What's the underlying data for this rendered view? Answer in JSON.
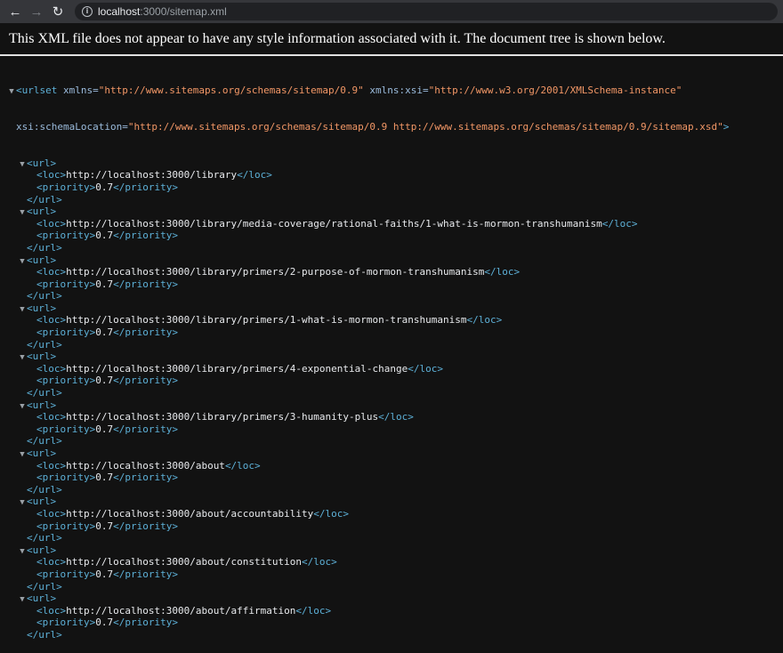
{
  "browser": {
    "url_host": "localhost",
    "url_path": ":3000/sitemap.xml"
  },
  "banner": "This XML file does not appear to have any style information associated with it. The document tree is shown below.",
  "root": {
    "tag": "urlset",
    "attr1_name": "xmlns",
    "attr1_value": "\"http://www.sitemaps.org/schemas/sitemap/0.9\"",
    "attr2_name": "xmlns:xsi",
    "attr2_value": "\"http://www.w3.org/2001/XMLSchema-instance\"",
    "attr3_name": "xsi:schemaLocation",
    "attr3_value": "\"http://www.sitemaps.org/schemas/sitemap/0.9 http://www.sitemaps.org/schemas/sitemap/0.9/sitemap.xsd\""
  },
  "urls": [
    {
      "loc": "http://localhost:3000/library",
      "priority": "0.7"
    },
    {
      "loc": "http://localhost:3000/library/media-coverage/rational-faiths/1-what-is-mormon-transhumanism",
      "priority": "0.7"
    },
    {
      "loc": "http://localhost:3000/library/primers/2-purpose-of-mormon-transhumanism",
      "priority": "0.7"
    },
    {
      "loc": "http://localhost:3000/library/primers/1-what-is-mormon-transhumanism",
      "priority": "0.7"
    },
    {
      "loc": "http://localhost:3000/library/primers/4-exponential-change",
      "priority": "0.7"
    },
    {
      "loc": "http://localhost:3000/library/primers/3-humanity-plus",
      "priority": "0.7"
    },
    {
      "loc": "http://localhost:3000/about",
      "priority": "0.7"
    },
    {
      "loc": "http://localhost:3000/about/accountability",
      "priority": "0.7"
    },
    {
      "loc": "http://localhost:3000/about/constitution",
      "priority": "0.7"
    },
    {
      "loc": "http://localhost:3000/about/affirmation",
      "priority": "0.7"
    }
  ]
}
